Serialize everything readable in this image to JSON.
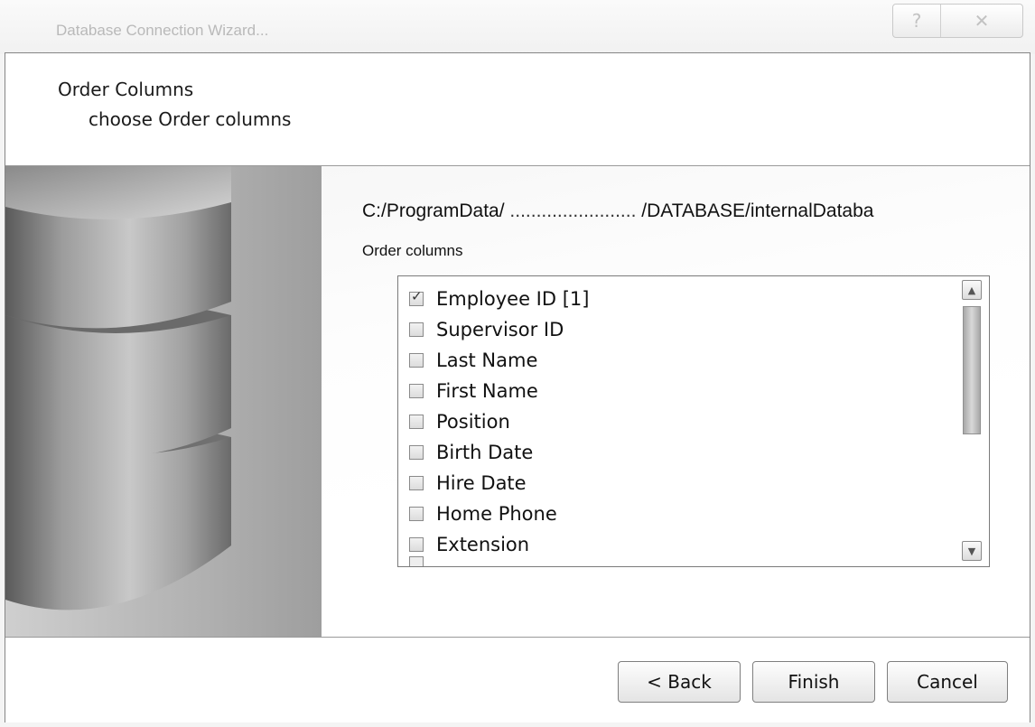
{
  "window": {
    "title": "Database Connection Wizard...",
    "help_glyph": "?",
    "close_glyph": "✕"
  },
  "header": {
    "title": "Order Columns",
    "subtitle": "choose  Order columns"
  },
  "content": {
    "path_prefix": "C:/ProgramData/",
    "path_redacted": "........................",
    "path_suffix": "/DATABASE/internalDataba",
    "order_label": "Order columns",
    "columns": [
      {
        "label": "Employee ID [1]",
        "checked": true
      },
      {
        "label": "Supervisor ID",
        "checked": false
      },
      {
        "label": "Last Name",
        "checked": false
      },
      {
        "label": "First Name",
        "checked": false
      },
      {
        "label": "Position",
        "checked": false
      },
      {
        "label": "Birth Date",
        "checked": false
      },
      {
        "label": "Hire Date",
        "checked": false
      },
      {
        "label": "Home Phone",
        "checked": false
      },
      {
        "label": "Extension",
        "checked": false
      }
    ]
  },
  "footer": {
    "back_label": "< Back",
    "finish_label": "Finish",
    "cancel_label": "Cancel"
  }
}
